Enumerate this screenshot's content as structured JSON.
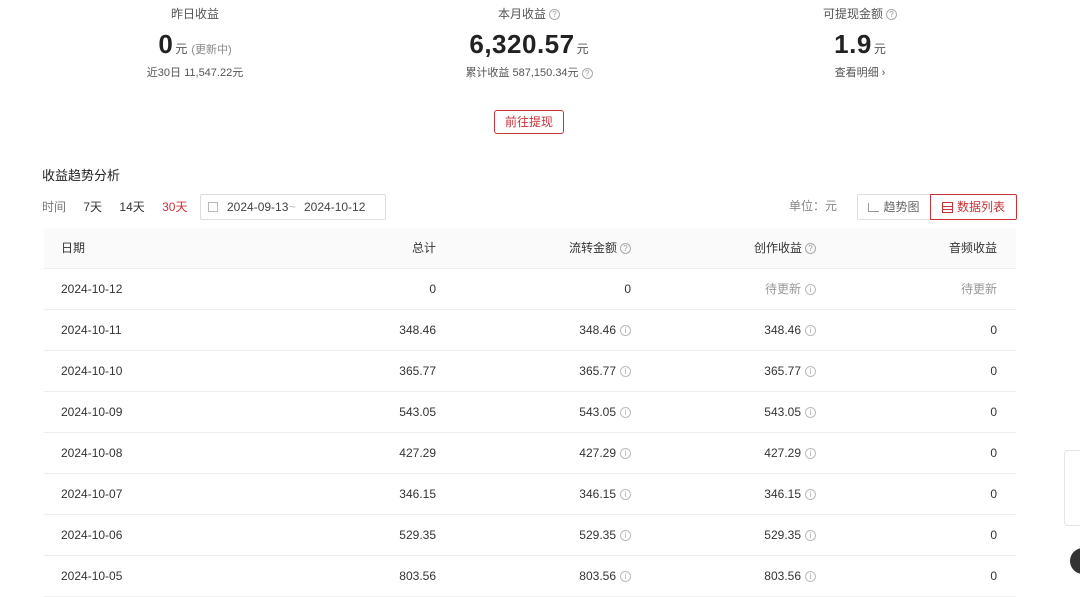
{
  "stats": {
    "yesterday": {
      "label": "昨日收益",
      "value": "0",
      "unit": "元",
      "note": "(更新中)",
      "sub_label": "近30日",
      "sub_value": "11,547.22元"
    },
    "month": {
      "label": "本月收益",
      "value": "6,320.57",
      "unit": "元",
      "sub_label": "累计收益",
      "sub_value": "587,150.34元"
    },
    "withdrawable": {
      "label": "可提现金额",
      "value": "1.9",
      "unit": "元",
      "link": "查看明细 ›"
    }
  },
  "withdraw_button": "前往提现",
  "section": {
    "title": "收益趋势分析"
  },
  "filters": {
    "label": "时间",
    "options": [
      "7天",
      "14天",
      "30天"
    ],
    "active": "30天"
  },
  "date_range": {
    "start": "2024-09-13",
    "separator": "~",
    "end": "2024-10-12"
  },
  "unit_label": "单位：元",
  "view_toggle": {
    "trend": "趋势图",
    "list": "数据列表",
    "active": "list"
  },
  "table": {
    "headers": [
      "日期",
      "总计",
      "流转金额",
      "创作收益",
      "音频收益"
    ],
    "rows": [
      [
        "2024-10-12",
        "0",
        "0",
        "待更新",
        "待更新"
      ],
      [
        "2024-10-11",
        "348.46",
        "348.46",
        "348.46",
        "0"
      ],
      [
        "2024-10-10",
        "365.77",
        "365.77",
        "365.77",
        "0"
      ],
      [
        "2024-10-09",
        "543.05",
        "543.05",
        "543.05",
        "0"
      ],
      [
        "2024-10-08",
        "427.29",
        "427.29",
        "427.29",
        "0"
      ],
      [
        "2024-10-07",
        "346.15",
        "346.15",
        "346.15",
        "0"
      ],
      [
        "2024-10-06",
        "529.35",
        "529.35",
        "529.35",
        "0"
      ],
      [
        "2024-10-05",
        "803.56",
        "803.56",
        "803.56",
        "0"
      ]
    ]
  },
  "colors": {
    "accent": "#c8333a"
  }
}
